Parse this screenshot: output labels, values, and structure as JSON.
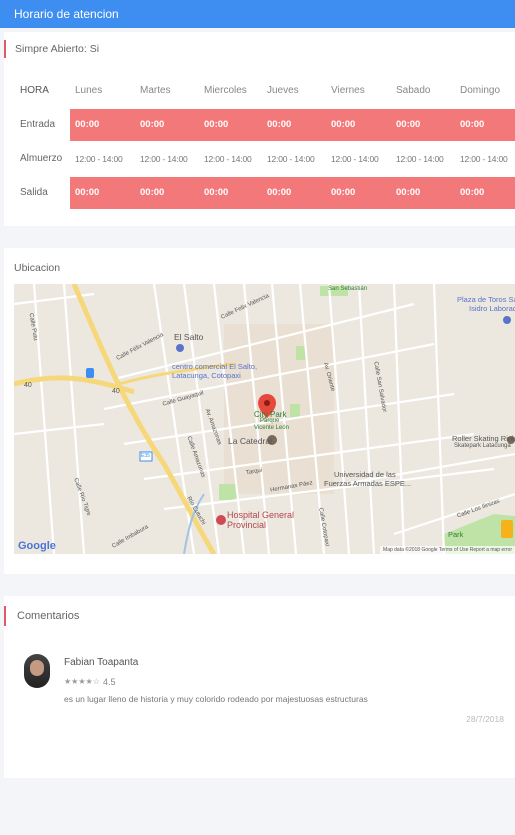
{
  "header": {
    "title": "Horario de atencion"
  },
  "hours": {
    "always_open": "Simpre Abierto: Si",
    "header": {
      "label": "HORA",
      "days": [
        "Lunes",
        "Martes",
        "Miercoles",
        "Jueves",
        "Viernes",
        "Sabado",
        "Domingo"
      ]
    },
    "rows": [
      {
        "label": "Entrada",
        "values": [
          "00:00",
          "00:00",
          "00:00",
          "00:00",
          "00:00",
          "00:00",
          "00:00"
        ]
      },
      {
        "label": "Almuerzo",
        "values": [
          "12:00 - 14:00",
          "12:00 - 14:00",
          "12:00 - 14:00",
          "12:00 - 14:00",
          "12:00 - 14:00",
          "12:00 - 14:00",
          "12:00 - 14:00"
        ]
      },
      {
        "label": "Salida",
        "values": [
          "00:00",
          "00:00",
          "00:00",
          "00:00",
          "00:00",
          "00:00",
          "00:00"
        ]
      }
    ],
    "highlight_color": "#f3787a"
  },
  "location": {
    "title": "Ubicacion",
    "map": {
      "labels": {
        "el_salto": "El Salto",
        "centro_comercial": "centro comercial El Salto,",
        "centro_comercial_2": "Latacunga, Cotopaxi",
        "city_park": "City Park",
        "parque": "Parque",
        "vicente": "Vicente León",
        "catedral": "La Catedral",
        "universidad": "Universidad de las",
        "universidad_2": "Fuerzas Armadas ESPE...",
        "hospital": "Hospital General",
        "hospital_2": "Provincial",
        "plaza": "Plaza de Toros Sa",
        "plaza_2": "Isidro Laborado",
        "roller": "Roller Skating Rink",
        "roller_2": "Skatepark Latacunga",
        "park": "Park",
        "san_sebastian": "San Sebastián",
        "calle_felix": "Calle Felix Valencia",
        "calle_felix_2": "Calle Félix Valencia",
        "calle_guayaquil": "Calle Guayaquil",
        "calle_tarqui": "Tarqui",
        "hermanas_paez": "Hermanas Páez",
        "calle_los_linizas": "Calle Los Ilinizas",
        "calle_san_salvador": "Calle San Salvador",
        "av_amazonas": "Av. Amazonas",
        "av_oriente": "Av. Oriente",
        "calle_amazonas": "Calle Amazonas",
        "rio_cutuchi": "Río Cutuchi",
        "calle_imbabura": "Calle Imbabura",
        "calle_rio": "Calle Río Tigre",
        "calle_cotopaxi": "Calle Cotopaxi",
        "calle_putu": "Calle Putu",
        "route_40": "40",
        "route_40b": "40",
        "route_e35": "E35",
        "map_data": "Map data ©2018 Google",
        "terms": "Terms of Use",
        "report": "Report a map error"
      },
      "logo": "Google"
    }
  },
  "comments": {
    "title": "Comentarios",
    "items": [
      {
        "author": "Fabian Toapanta",
        "stars": "★★★★☆",
        "rating": "4.5",
        "text": "es un lugar lleno de historia y muy colorido rodeado por majestuosas estructuras",
        "date": "28/7/2018"
      }
    ]
  }
}
